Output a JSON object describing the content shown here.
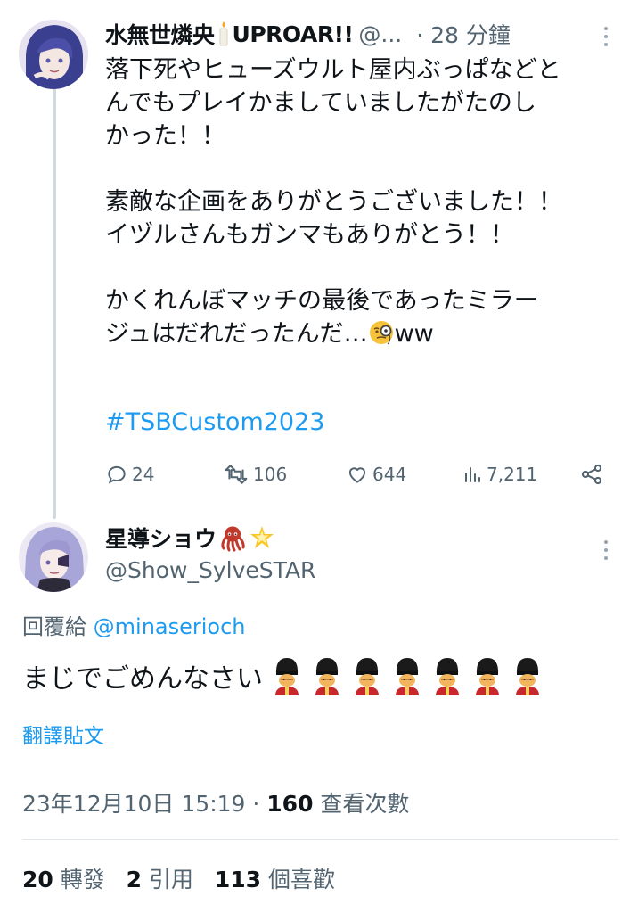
{
  "thread_tweet": {
    "author_name": "水無世燐央",
    "author_name_suffix": "UPROAR!!",
    "handle_truncated": "@...",
    "separator": "·",
    "time": "28 分鐘",
    "text_lines": "落下死やヒューズウルト屋内ぶっぱなどと\nんでもプレイかましていましたがたのし\nかった！！\n\n素敵な企画をありがとうございました！！\nイヅルさんもガンマもありがとう！！\n\nかくれんぼマッチの最後であったミラー\nジュはだれだったんだ…",
    "text_tail": "ww",
    "hashtag": "#TSBCustom2023",
    "actions": {
      "replies": "24",
      "retweets": "106",
      "likes": "644",
      "views": "7,211"
    }
  },
  "main_tweet": {
    "author_name": "星導ショウ",
    "handle": "@Show_SylveSTAR",
    "reply_to_label": "回覆給",
    "reply_to_handle": "@minaserioch",
    "text": "まじでごめんなさい",
    "translate_label": "翻譯貼文",
    "timestamp": "23年12月10日 15:19",
    "meta_sep": " · ",
    "views_count": "160",
    "views_label": "查看次數",
    "stats": {
      "retweets": "20",
      "retweets_label": "轉發",
      "quotes": "2",
      "quotes_label": "引用",
      "likes": "113",
      "likes_label": "個喜歡"
    }
  },
  "icons": [
    "more-icon",
    "reply-icon",
    "retweet-icon",
    "like-icon",
    "views-icon",
    "share-icon",
    "candle-emoji",
    "octopus-emoji",
    "sparkle-star-emoji",
    "monocle-face-emoji",
    "guard-emoji"
  ],
  "colors": {
    "link": "#1d9bf0",
    "muted": "#536471",
    "text": "#0f1419",
    "thread_line": "#cfd9de"
  }
}
